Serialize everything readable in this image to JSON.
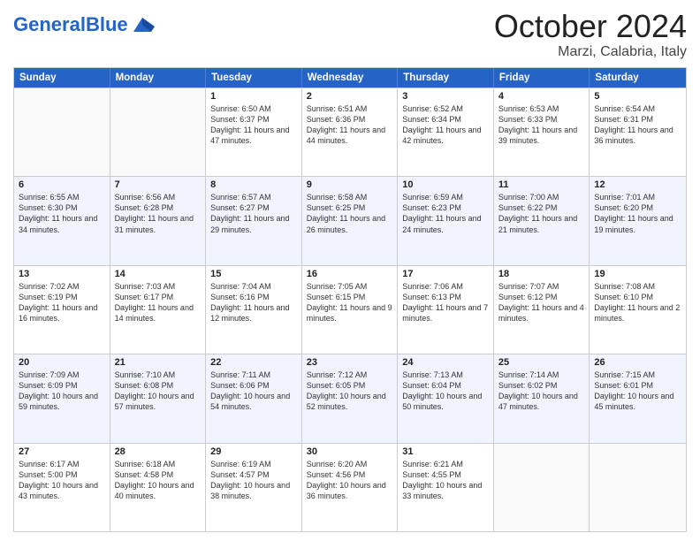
{
  "header": {
    "logo_general": "General",
    "logo_blue": "Blue",
    "month_title": "October 2024",
    "location": "Marzi, Calabria, Italy"
  },
  "days_of_week": [
    "Sunday",
    "Monday",
    "Tuesday",
    "Wednesday",
    "Thursday",
    "Friday",
    "Saturday"
  ],
  "weeks": [
    {
      "alt": false,
      "cells": [
        {
          "day": "",
          "sunrise": "",
          "sunset": "",
          "daylight": ""
        },
        {
          "day": "",
          "sunrise": "",
          "sunset": "",
          "daylight": ""
        },
        {
          "day": "1",
          "sunrise": "Sunrise: 6:50 AM",
          "sunset": "Sunset: 6:37 PM",
          "daylight": "Daylight: 11 hours and 47 minutes."
        },
        {
          "day": "2",
          "sunrise": "Sunrise: 6:51 AM",
          "sunset": "Sunset: 6:36 PM",
          "daylight": "Daylight: 11 hours and 44 minutes."
        },
        {
          "day": "3",
          "sunrise": "Sunrise: 6:52 AM",
          "sunset": "Sunset: 6:34 PM",
          "daylight": "Daylight: 11 hours and 42 minutes."
        },
        {
          "day": "4",
          "sunrise": "Sunrise: 6:53 AM",
          "sunset": "Sunset: 6:33 PM",
          "daylight": "Daylight: 11 hours and 39 minutes."
        },
        {
          "day": "5",
          "sunrise": "Sunrise: 6:54 AM",
          "sunset": "Sunset: 6:31 PM",
          "daylight": "Daylight: 11 hours and 36 minutes."
        }
      ]
    },
    {
      "alt": true,
      "cells": [
        {
          "day": "6",
          "sunrise": "Sunrise: 6:55 AM",
          "sunset": "Sunset: 6:30 PM",
          "daylight": "Daylight: 11 hours and 34 minutes."
        },
        {
          "day": "7",
          "sunrise": "Sunrise: 6:56 AM",
          "sunset": "Sunset: 6:28 PM",
          "daylight": "Daylight: 11 hours and 31 minutes."
        },
        {
          "day": "8",
          "sunrise": "Sunrise: 6:57 AM",
          "sunset": "Sunset: 6:27 PM",
          "daylight": "Daylight: 11 hours and 29 minutes."
        },
        {
          "day": "9",
          "sunrise": "Sunrise: 6:58 AM",
          "sunset": "Sunset: 6:25 PM",
          "daylight": "Daylight: 11 hours and 26 minutes."
        },
        {
          "day": "10",
          "sunrise": "Sunrise: 6:59 AM",
          "sunset": "Sunset: 6:23 PM",
          "daylight": "Daylight: 11 hours and 24 minutes."
        },
        {
          "day": "11",
          "sunrise": "Sunrise: 7:00 AM",
          "sunset": "Sunset: 6:22 PM",
          "daylight": "Daylight: 11 hours and 21 minutes."
        },
        {
          "day": "12",
          "sunrise": "Sunrise: 7:01 AM",
          "sunset": "Sunset: 6:20 PM",
          "daylight": "Daylight: 11 hours and 19 minutes."
        }
      ]
    },
    {
      "alt": false,
      "cells": [
        {
          "day": "13",
          "sunrise": "Sunrise: 7:02 AM",
          "sunset": "Sunset: 6:19 PM",
          "daylight": "Daylight: 11 hours and 16 minutes."
        },
        {
          "day": "14",
          "sunrise": "Sunrise: 7:03 AM",
          "sunset": "Sunset: 6:17 PM",
          "daylight": "Daylight: 11 hours and 14 minutes."
        },
        {
          "day": "15",
          "sunrise": "Sunrise: 7:04 AM",
          "sunset": "Sunset: 6:16 PM",
          "daylight": "Daylight: 11 hours and 12 minutes."
        },
        {
          "day": "16",
          "sunrise": "Sunrise: 7:05 AM",
          "sunset": "Sunset: 6:15 PM",
          "daylight": "Daylight: 11 hours and 9 minutes."
        },
        {
          "day": "17",
          "sunrise": "Sunrise: 7:06 AM",
          "sunset": "Sunset: 6:13 PM",
          "daylight": "Daylight: 11 hours and 7 minutes."
        },
        {
          "day": "18",
          "sunrise": "Sunrise: 7:07 AM",
          "sunset": "Sunset: 6:12 PM",
          "daylight": "Daylight: 11 hours and 4 minutes."
        },
        {
          "day": "19",
          "sunrise": "Sunrise: 7:08 AM",
          "sunset": "Sunset: 6:10 PM",
          "daylight": "Daylight: 11 hours and 2 minutes."
        }
      ]
    },
    {
      "alt": true,
      "cells": [
        {
          "day": "20",
          "sunrise": "Sunrise: 7:09 AM",
          "sunset": "Sunset: 6:09 PM",
          "daylight": "Daylight: 10 hours and 59 minutes."
        },
        {
          "day": "21",
          "sunrise": "Sunrise: 7:10 AM",
          "sunset": "Sunset: 6:08 PM",
          "daylight": "Daylight: 10 hours and 57 minutes."
        },
        {
          "day": "22",
          "sunrise": "Sunrise: 7:11 AM",
          "sunset": "Sunset: 6:06 PM",
          "daylight": "Daylight: 10 hours and 54 minutes."
        },
        {
          "day": "23",
          "sunrise": "Sunrise: 7:12 AM",
          "sunset": "Sunset: 6:05 PM",
          "daylight": "Daylight: 10 hours and 52 minutes."
        },
        {
          "day": "24",
          "sunrise": "Sunrise: 7:13 AM",
          "sunset": "Sunset: 6:04 PM",
          "daylight": "Daylight: 10 hours and 50 minutes."
        },
        {
          "day": "25",
          "sunrise": "Sunrise: 7:14 AM",
          "sunset": "Sunset: 6:02 PM",
          "daylight": "Daylight: 10 hours and 47 minutes."
        },
        {
          "day": "26",
          "sunrise": "Sunrise: 7:15 AM",
          "sunset": "Sunset: 6:01 PM",
          "daylight": "Daylight: 10 hours and 45 minutes."
        }
      ]
    },
    {
      "alt": false,
      "cells": [
        {
          "day": "27",
          "sunrise": "Sunrise: 6:17 AM",
          "sunset": "Sunset: 5:00 PM",
          "daylight": "Daylight: 10 hours and 43 minutes."
        },
        {
          "day": "28",
          "sunrise": "Sunrise: 6:18 AM",
          "sunset": "Sunset: 4:58 PM",
          "daylight": "Daylight: 10 hours and 40 minutes."
        },
        {
          "day": "29",
          "sunrise": "Sunrise: 6:19 AM",
          "sunset": "Sunset: 4:57 PM",
          "daylight": "Daylight: 10 hours and 38 minutes."
        },
        {
          "day": "30",
          "sunrise": "Sunrise: 6:20 AM",
          "sunset": "Sunset: 4:56 PM",
          "daylight": "Daylight: 10 hours and 36 minutes."
        },
        {
          "day": "31",
          "sunrise": "Sunrise: 6:21 AM",
          "sunset": "Sunset: 4:55 PM",
          "daylight": "Daylight: 10 hours and 33 minutes."
        },
        {
          "day": "",
          "sunrise": "",
          "sunset": "",
          "daylight": ""
        },
        {
          "day": "",
          "sunrise": "",
          "sunset": "",
          "daylight": ""
        }
      ]
    }
  ]
}
